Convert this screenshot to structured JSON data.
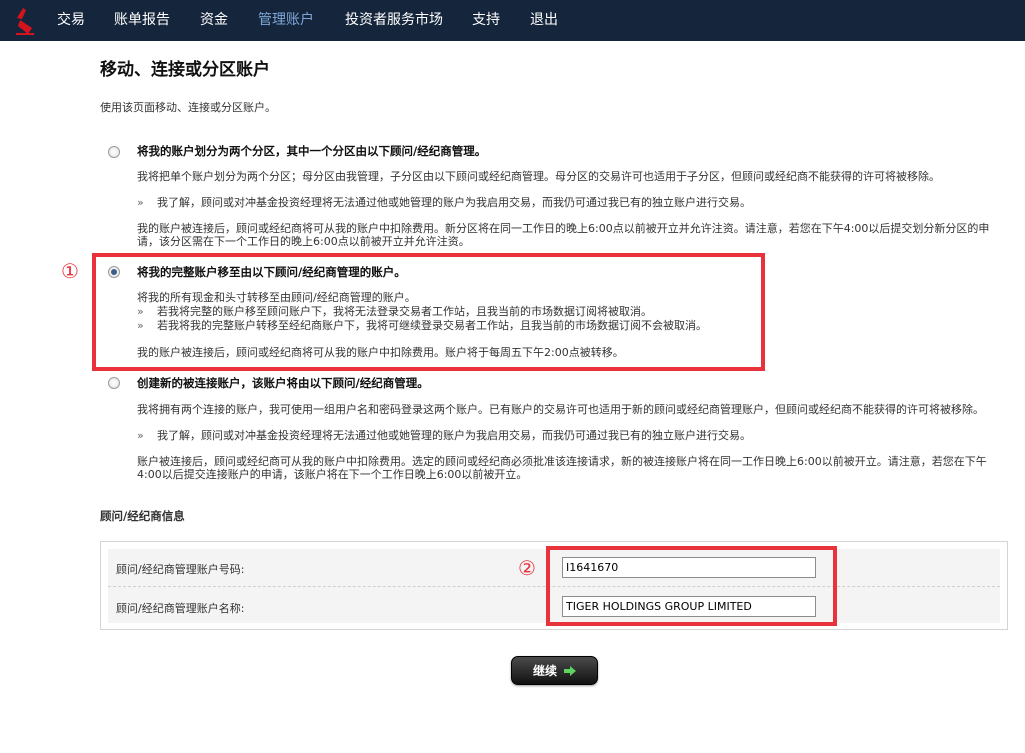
{
  "nav": {
    "items": [
      {
        "label": "交易"
      },
      {
        "label": "账单报告"
      },
      {
        "label": "资金"
      },
      {
        "label": "管理账户"
      },
      {
        "label": "投资者服务市场"
      },
      {
        "label": "支持"
      },
      {
        "label": "退出"
      }
    ],
    "active_index": 3,
    "logo_icon": "logo-icon"
  },
  "page": {
    "title": "移动、连接或分区账户",
    "description": "使用该页面移动、连接或分区账户。"
  },
  "options": [
    {
      "title": "将我的账户划分为两个分区，其中一个分区由以下顾问/经纪商管理。",
      "selected": false,
      "p1": "我将把单个账户划分为两个分区；母分区由我管理，子分区由以下顾问或经纪商管理。母分区的交易许可也适用于子分区，但顾问或经纪商不能获得的许可将被移除。",
      "bullet1": "我了解，顾问或对冲基金投资经理将无法通过他或她管理的账户为我启用交易，而我仍可通过我已有的独立账户进行交易。",
      "p2": "我的账户被连接后，顾问或经纪商将可从我的账户中扣除费用。新分区将在同一工作日的晚上6:00点以前被开立并允许注资。请注意，若您在下午4:00以后提交划分新分区的申请，该分区需在下一个工作日的晚上6:00点以前被开立并允许注资。"
    },
    {
      "title": "将我的完整账户移至由以下顾问/经纪商管理的账户。",
      "selected": true,
      "p1": "将我的所有现金和头寸转移至由顾问/经纪商管理的账户。",
      "bullet1": "若我将完整的账户移至顾问账户下，我将无法登录交易者工作站，且我当前的市场数据订阅将被取消。",
      "bullet2": "若我将我的完整账户转移至经纪商账户下，我将可继续登录交易者工作站，且我当前的市场数据订阅不会被取消。",
      "p2": "我的账户被连接后，顾问或经纪商将可从我的账户中扣除费用。账户将于每周五下午2:00点被转移。"
    },
    {
      "title": "创建新的被连接账户，该账户将由以下顾问/经纪商管理。",
      "selected": false,
      "p1": "我将拥有两个连接的账户，我可使用一组用户名和密码登录这两个账户。已有账户的交易许可也适用于新的顾问或经纪商管理账户，但顾问或经纪商不能获得的许可将被移除。",
      "bullet1": "我了解，顾问或对冲基金投资经理将无法通过他或她管理的账户为我启用交易，而我仍可通过我已有的独立账户进行交易。",
      "p2": "账户被连接后，顾问或经纪商可从我的账户中扣除费用。选定的顾问或经纪商必须批准该连接请求，新的被连接账户将在同一工作日晚上6:00以前被开立。请注意，若您在下午4:00以后提交连接账户的申请，该账户将在下一个工作日晚上6:00以前被开立。"
    }
  ],
  "bullet_glyph": "»",
  "annotations": {
    "marker1": "①",
    "marker2": "②",
    "color": "#e8323c"
  },
  "advisor": {
    "section_title": "顾问/经纪商信息",
    "account_number_label": "顾问/经纪商管理账户号码:",
    "account_number_value": "I1641670",
    "account_name_label": "顾问/经纪商管理账户名称:",
    "account_name_value": "TIGER HOLDINGS GROUP LIMITED"
  },
  "continue_button": {
    "label": "继续",
    "icon": "arrow-right-icon",
    "icon_color": "#5fd35f"
  }
}
